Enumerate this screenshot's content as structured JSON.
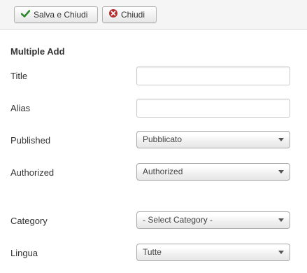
{
  "toolbar": {
    "save_close_label": "Salva e Chiudi",
    "close_label": "Chiudi",
    "colors": {
      "save_icon": "#2f8a2f",
      "close_icon": "#b52d2d"
    }
  },
  "form": {
    "heading": "Multiple Add",
    "title_label": "Title",
    "title_value": "",
    "alias_label": "Alias",
    "alias_value": "",
    "published_label": "Published",
    "published_selected": "Pubblicato",
    "authorized_label": "Authorized",
    "authorized_selected": "Authorized",
    "category_label": "Category",
    "category_selected": "- Select Category -",
    "language_label": "Lingua",
    "language_selected": "Tutte"
  }
}
